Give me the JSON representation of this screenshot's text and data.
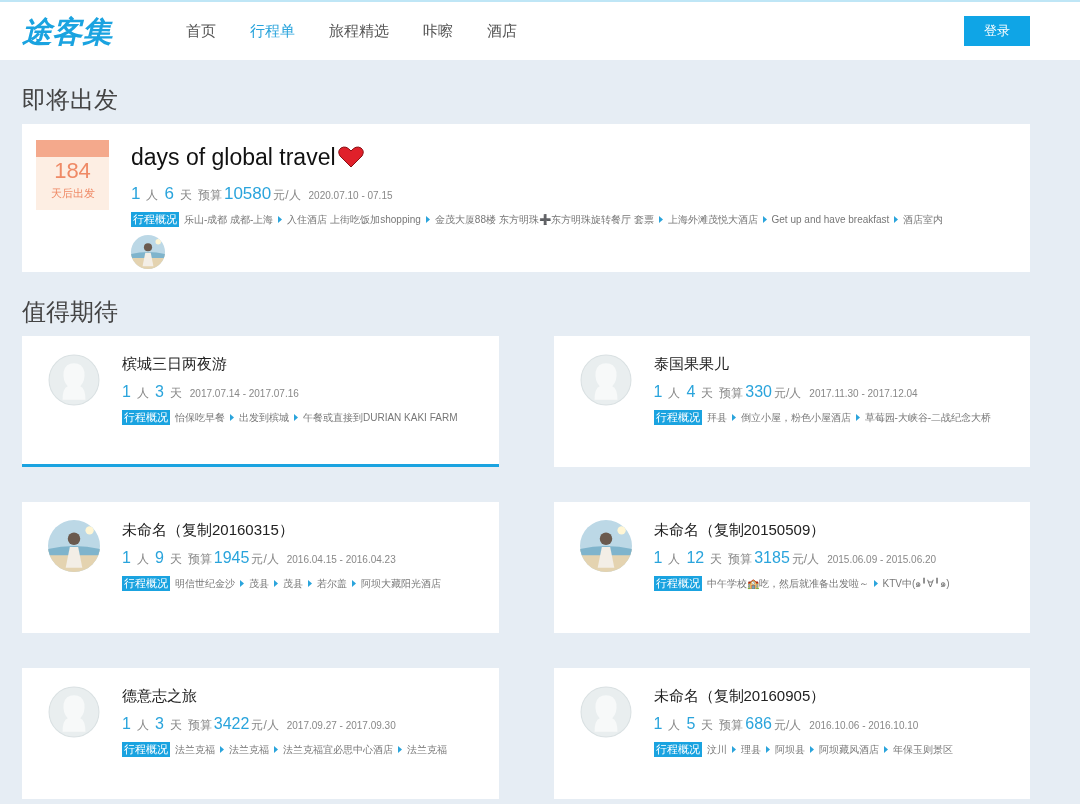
{
  "header": {
    "logo": "途客集",
    "nav": [
      {
        "label": "首页",
        "selected": false
      },
      {
        "label": "行程单",
        "selected": true
      },
      {
        "label": "旅程精选",
        "selected": false
      },
      {
        "label": "咔嚓",
        "selected": false
      },
      {
        "label": "酒店",
        "selected": false
      }
    ],
    "login": "登录"
  },
  "upcoming": {
    "heading": "即将出发",
    "card": {
      "countdown": "184",
      "countdown_label": "天后出发",
      "title": "days of global travel",
      "people": "1",
      "people_unit": "人",
      "days": "6",
      "days_unit": "天",
      "budget_label": "预算",
      "budget": "10580",
      "budget_unit": "元/人",
      "dates": "2020.07.10 - 07.15",
      "overview_label": "行程概况",
      "route": [
        "乐山-成都 成都-上海",
        "入住酒店 上街吃饭加shopping",
        "金茂大厦88楼 东方明珠➕东方明珠旋转餐厅 套票",
        "上海外滩茂悦大酒店",
        "Get up and have breakfast",
        "酒店室内"
      ],
      "avatar": {
        "kind": "picture"
      }
    }
  },
  "featured": {
    "heading": "值得期待",
    "cards": [
      {
        "title": "槟城三日两夜游",
        "people": "1",
        "people_unit": "人",
        "days": "3",
        "days_unit": "天",
        "dates": "2017.07.14 - 2017.07.16",
        "overview_label": "行程概况",
        "route": [
          "怡保吃早餐",
          "出发到槟城",
          "午餐或直接到DURIAN KAKI FARM"
        ],
        "avatar": {
          "kind": "silhouette"
        },
        "selected": true
      },
      {
        "title": "泰国果果儿",
        "people": "1",
        "people_unit": "人",
        "days": "4",
        "days_unit": "天",
        "budget_label": "预算",
        "budget": "330",
        "budget_unit": "元/人",
        "dates": "2017.11.30 - 2017.12.04",
        "overview_label": "行程概况",
        "route": [
          "拜县",
          "倒立小屋，粉色小屋酒店",
          "草莓园-大峡谷-二战纪念大桥"
        ],
        "avatar": {
          "kind": "silhouette"
        },
        "selected": false
      },
      {
        "title": "未命名（复制20160315）",
        "people": "1",
        "people_unit": "人",
        "days": "9",
        "days_unit": "天",
        "budget_label": "预算",
        "budget": "1945",
        "budget_unit": "元/人",
        "dates": "2016.04.15 - 2016.04.23",
        "overview_label": "行程概况",
        "route": [
          "明信世纪金沙",
          "茂县",
          "茂县",
          "若尔盖",
          "阿坝大藏阳光酒店"
        ],
        "avatar": {
          "kind": "picture"
        },
        "selected": false
      },
      {
        "title": "未命名（复制20150509）",
        "people": "1",
        "people_unit": "人",
        "days": "12",
        "days_unit": "天",
        "budget_label": "预算",
        "budget": "3185",
        "budget_unit": "元/人",
        "dates": "2015.06.09 - 2015.06.20",
        "overview_label": "行程概况",
        "route": [
          "中午学校🏫吃，然后就准备出发啦～",
          "KTV中(๑╹∀╹๑)"
        ],
        "avatar": {
          "kind": "picture"
        },
        "selected": false
      },
      {
        "title": "德意志之旅",
        "people": "1",
        "people_unit": "人",
        "days": "3",
        "days_unit": "天",
        "budget_label": "预算",
        "budget": "3422",
        "budget_unit": "元/人",
        "dates": "2017.09.27 - 2017.09.30",
        "overview_label": "行程概况",
        "route": [
          "法兰克福",
          "法兰克福",
          "法兰克福宜必思中心酒店",
          "法兰克福"
        ],
        "avatar": {
          "kind": "silhouette"
        },
        "selected": false
      },
      {
        "title": "未命名（复制20160905）",
        "people": "1",
        "people_unit": "人",
        "days": "5",
        "days_unit": "天",
        "budget_label": "预算",
        "budget": "686",
        "budget_unit": "元/人",
        "dates": "2016.10.06 - 2016.10.10",
        "overview_label": "行程概况",
        "route": [
          "汶川",
          "理县",
          "阿坝县",
          "阿坝藏风酒店",
          "年保玉则景区"
        ],
        "avatar": {
          "kind": "silhouette"
        },
        "selected": false
      }
    ]
  }
}
